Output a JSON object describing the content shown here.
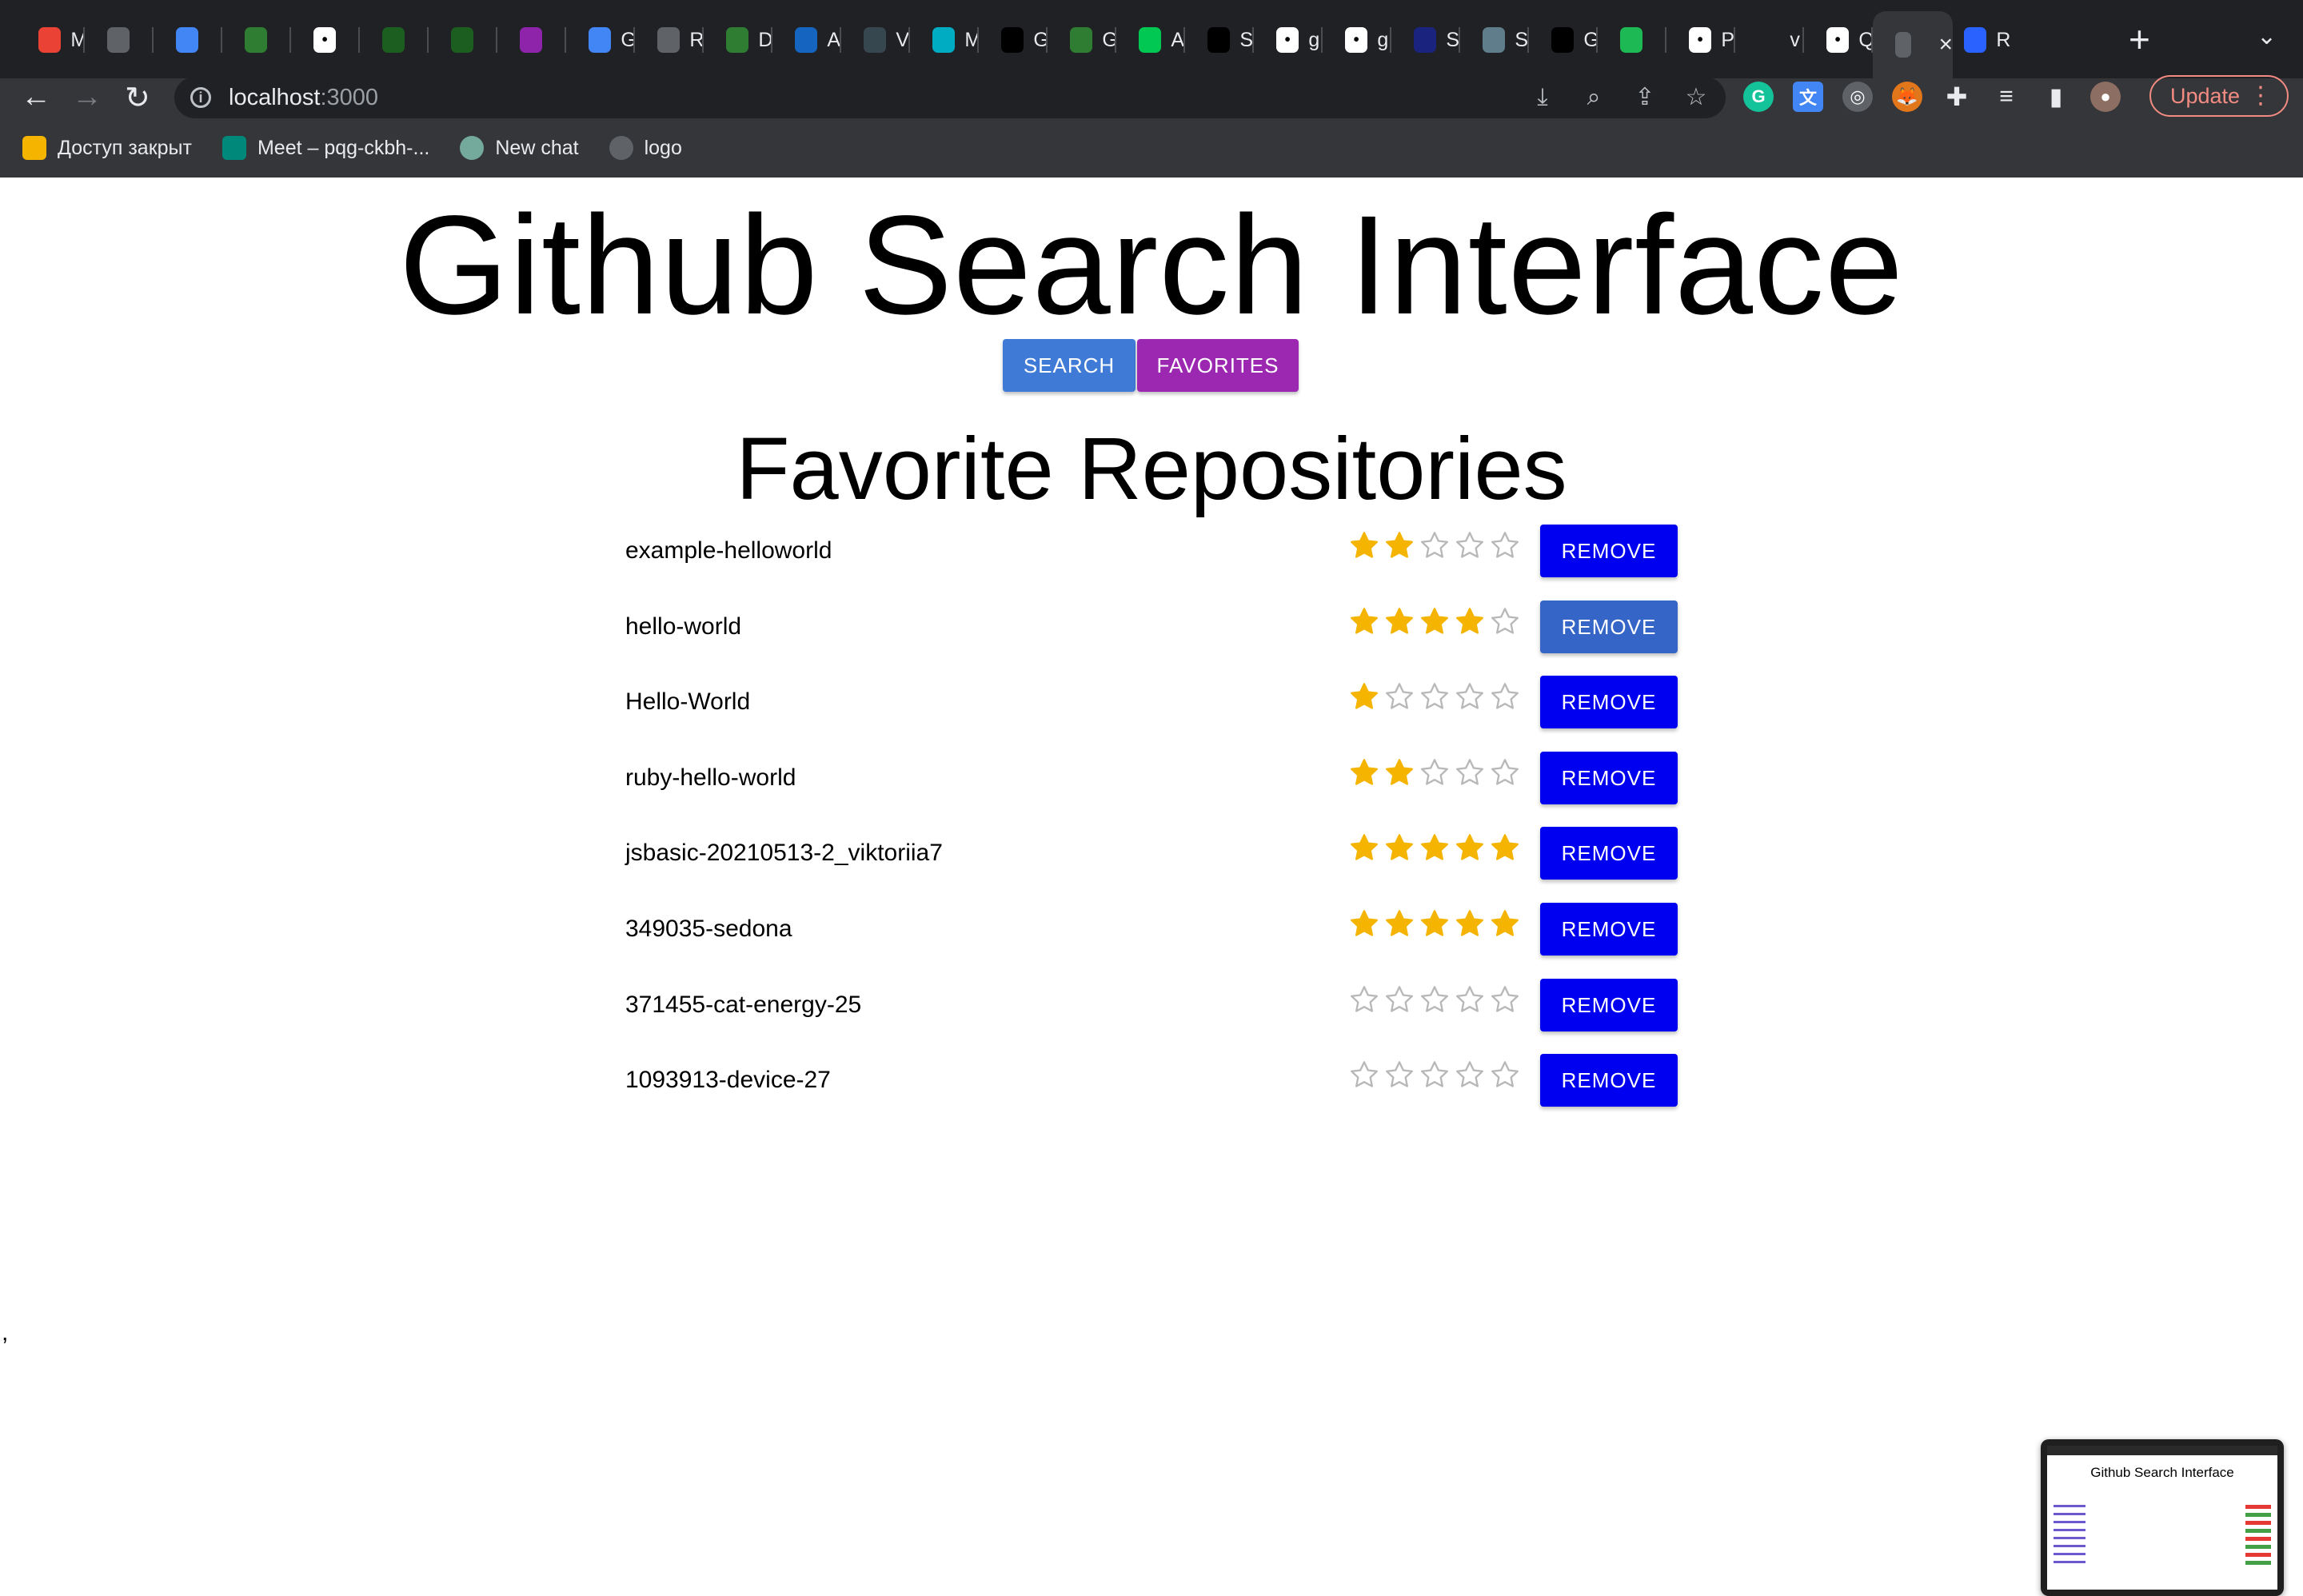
{
  "browser": {
    "tabs": [
      {
        "label": "M",
        "color": "#ea4335",
        "icon": "gmail-icon"
      },
      {
        "label": "",
        "color": "#5f6368",
        "icon": "globe-icon"
      },
      {
        "label": "",
        "color": "#4285f4",
        "icon": "calendar-icon"
      },
      {
        "label": "",
        "color": "#2e7d32",
        "icon": "vue-icon"
      },
      {
        "label": "",
        "color": "#ffffff",
        "icon": "w-icon"
      },
      {
        "label": "",
        "color": "#1b5e20",
        "icon": "dot-icon"
      },
      {
        "label": "",
        "color": "#1b5e20",
        "icon": "dot-icon"
      },
      {
        "label": "",
        "color": "#8e24aa",
        "icon": "orb-icon"
      },
      {
        "label": "G",
        "color": "#4285f4",
        "icon": "calendar-icon"
      },
      {
        "label": "R",
        "color": "#5f6368",
        "icon": "globe-icon"
      },
      {
        "label": "D",
        "color": "#2e7d32",
        "icon": "d-icon"
      },
      {
        "label": "A",
        "color": "#1565c0",
        "icon": "leaf-icon"
      },
      {
        "label": "V",
        "color": "#37474f",
        "icon": "vd-icon"
      },
      {
        "label": "M",
        "color": "#00acc1",
        "icon": "tailwind-icon"
      },
      {
        "label": "G",
        "color": "#000000",
        "icon": "n-icon"
      },
      {
        "label": "G",
        "color": "#2e7d32",
        "icon": "flask-icon"
      },
      {
        "label": "A",
        "color": "#00c853",
        "icon": "t-icon"
      },
      {
        "label": "S",
        "color": "#000000",
        "icon": "code-icon"
      },
      {
        "label": "g",
        "color": "#ffffff",
        "icon": "google-icon"
      },
      {
        "label": "g",
        "color": "#ffffff",
        "icon": "github-icon"
      },
      {
        "label": "S",
        "color": "#1a237e",
        "icon": "ring-icon"
      },
      {
        "label": "S",
        "color": "#607d8b",
        "icon": "chatgpt-icon"
      },
      {
        "label": "G",
        "color": "#000000",
        "icon": "n-icon"
      },
      {
        "label": "",
        "color": "#1db954",
        "icon": "spotify-icon"
      },
      {
        "label": "P",
        "color": "#ffffff",
        "icon": "github-icon"
      },
      {
        "label": "v",
        "color": "#202124",
        "icon": "blank-icon"
      },
      {
        "label": "Q",
        "color": "#ffffff",
        "icon": "a-icon"
      },
      {
        "label": "",
        "color": "#5f6368",
        "icon": "globe-icon",
        "active": true
      },
      {
        "label": "R",
        "color": "#2962ff",
        "icon": "mui-icon"
      }
    ],
    "new_tab": "+",
    "tab_search": "⌄",
    "url_host": "localhost",
    "url_port": ":3000",
    "update_label": "Update",
    "bookmarks": [
      {
        "label": "Доступ закрыт",
        "color": "#f4b400",
        "icon": "folder-icon"
      },
      {
        "label": "Meet – pqg-ckbh-...",
        "color": "#00897b",
        "icon": "meet-icon"
      },
      {
        "label": "New chat",
        "color": "#74aa9c",
        "icon": "chatgpt-icon"
      },
      {
        "label": "logo",
        "color": "#5f6368",
        "icon": "globe-icon"
      }
    ]
  },
  "app": {
    "title": "Github Search Interface",
    "nav": {
      "search_label": "SEARCH",
      "favorites_label": "FAVORITES"
    },
    "section_title": "Favorite Repositories",
    "remove_label": "REMOVE",
    "star_color": "#f4b400",
    "repos": [
      {
        "name": "example-helloworld",
        "rating": 2
      },
      {
        "name": "hello-world",
        "rating": 4
      },
      {
        "name": "Hello-World",
        "rating": 1
      },
      {
        "name": "ruby-hello-world",
        "rating": 2
      },
      {
        "name": "jsbasic-20210513-2_viktoriia7",
        "rating": 5
      },
      {
        "name": "349035-sedona",
        "rating": 5
      },
      {
        "name": "371455-cat-energy-25",
        "rating": 0
      },
      {
        "name": "1093913-device-27",
        "rating": 0
      }
    ],
    "stray_text": ",",
    "thumbnail_title": "Github Search Interface"
  }
}
